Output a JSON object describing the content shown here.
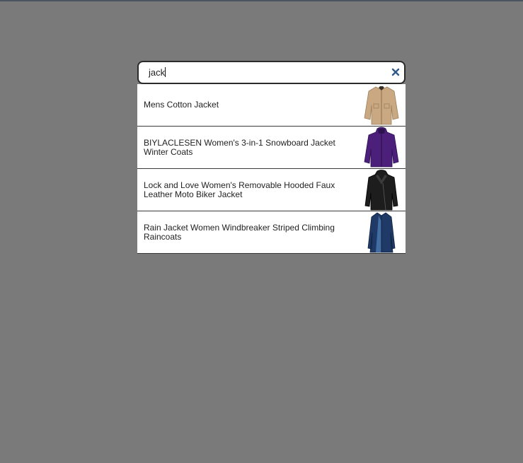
{
  "search": {
    "value": "jack",
    "clear_icon": "close-icon"
  },
  "results": [
    {
      "label": "Mens Cotton Jacket",
      "thumb_icon": "jacket-thumbnail",
      "color": "#c9a882"
    },
    {
      "label": "BIYLACLESEN Women's 3-in-1 Snowboard Jacket Winter Coats",
      "thumb_icon": "jacket-thumbnail",
      "color": "#4b1f7a"
    },
    {
      "label": "Lock and Love Women's Removable Hooded Faux Leather Moto Biker Jacket",
      "thumb_icon": "jacket-thumbnail",
      "color": "#1d1d1d"
    },
    {
      "label": "Rain Jacket Women Windbreaker Striped Climbing Raincoats",
      "thumb_icon": "jacket-thumbnail",
      "color": "#1f3a66"
    }
  ],
  "colors": {
    "backdrop": "#7a7a7a",
    "clear_icon": "#2f5a8a"
  }
}
